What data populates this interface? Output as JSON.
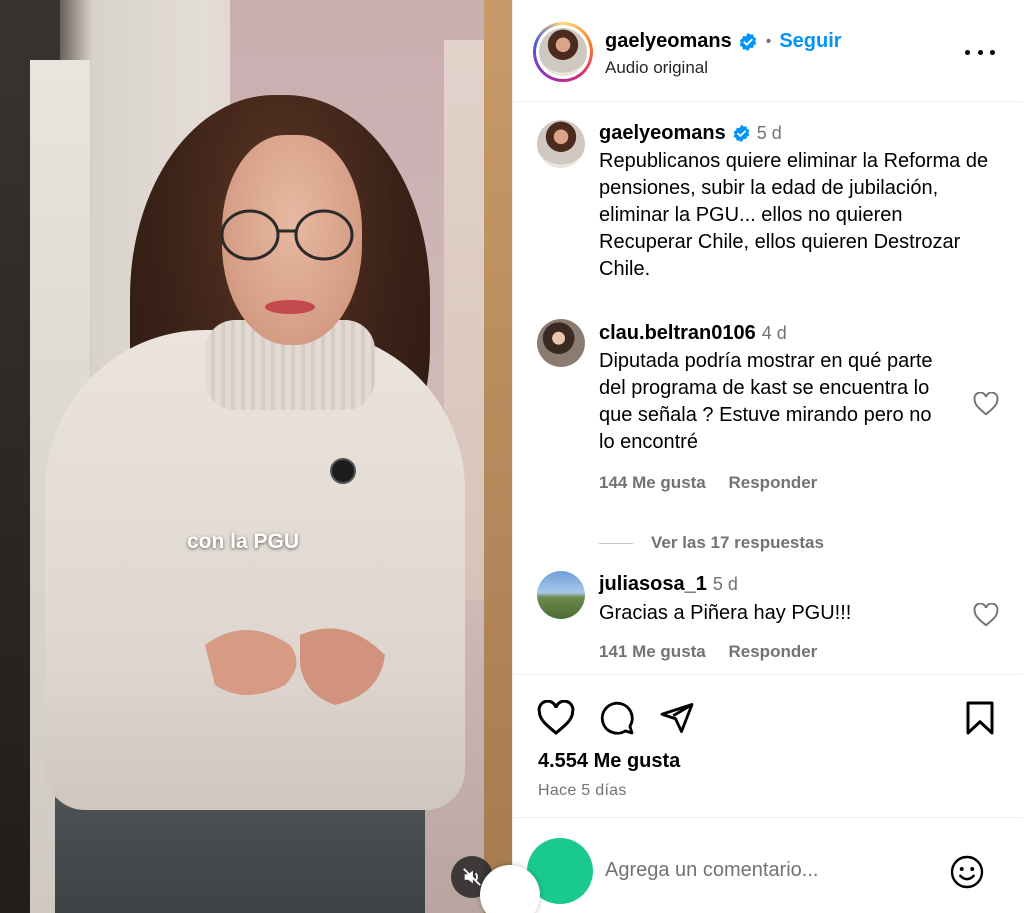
{
  "video": {
    "caption": "con la PGU",
    "mute_icon": "speaker-muted-icon"
  },
  "header": {
    "username": "gaelyeomans",
    "separator": "•",
    "follow_label": "Seguir",
    "audio_label": "Audio original",
    "more_icon": "more-horizontal-icon"
  },
  "caption_post": {
    "username": "gaelyeomans",
    "time": "5 d",
    "text": "Republicanos quiere eliminar la Reforma de pensiones, subir la edad de jubilación, eliminar la PGU... ellos no quieren Recuperar Chile, ellos quieren Destrozar Chile."
  },
  "comments": [
    {
      "username": "clau.beltran0106",
      "time": "4 d",
      "text": "Diputada podría mostrar en qué parte del programa de kast se encuentra lo que señala ? Estuve mirando pero no lo encontré",
      "likes": "144 Me gusta",
      "reply_label": "Responder",
      "view_replies": "Ver las 17 respuestas"
    },
    {
      "username": "juliasosa_1",
      "time": "5 d",
      "text": "Gracias a Piñera hay PGU!!!",
      "likes": "141 Me gusta",
      "reply_label": "Responder"
    }
  ],
  "actions": {
    "likes_count": "4.554 Me gusta",
    "posted_ago": "Hace 5 días"
  },
  "add_comment": {
    "placeholder": "Agrega un comentario..."
  },
  "colors": {
    "link_blue": "#0095f6",
    "muted_text": "#737373",
    "verified_blue": "#0095f6",
    "user_avatar": "#19c98f"
  }
}
